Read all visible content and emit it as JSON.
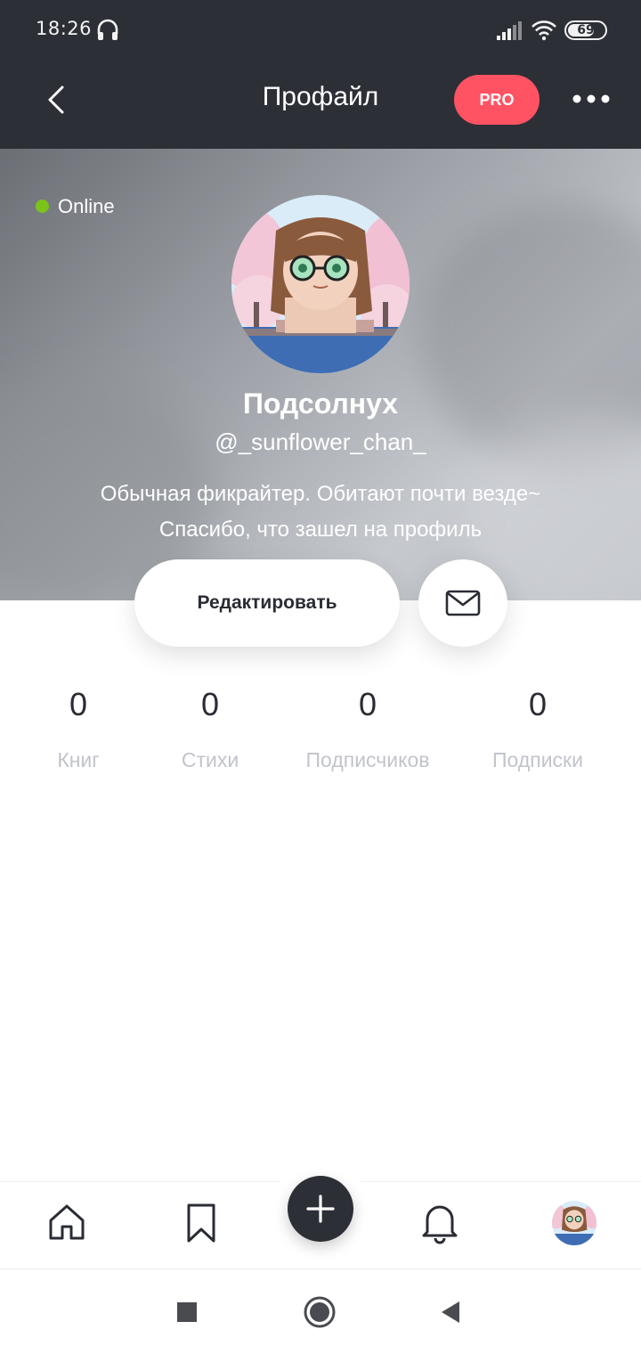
{
  "status_bar": {
    "time": "18:26",
    "battery": "69"
  },
  "app_bar": {
    "title": "Профайл",
    "pro_label": "PRO"
  },
  "profile": {
    "status": "Online",
    "name": "Подсолнух",
    "handle": "@_sunflower_chan_",
    "bio_line1": "Обычная фикрайтер. Обитают почти везде~",
    "bio_line2": "Спасибо, что зашел на профиль"
  },
  "actions": {
    "edit_label": "Редактировать"
  },
  "stats": [
    {
      "value": "0",
      "label": "Книг"
    },
    {
      "value": "0",
      "label": "Стихи"
    },
    {
      "value": "0",
      "label": "Подписчиков"
    },
    {
      "value": "0",
      "label": "Подписки"
    }
  ],
  "bottom_nav": [
    "home-icon",
    "bookmark-icon",
    "plus-icon",
    "bell-icon",
    "profile-avatar"
  ],
  "colors": {
    "header_bg": "#2d2f37",
    "pro_accent": "#ff5363",
    "online": "#7bc31a",
    "muted_label": "#c2c4cb"
  }
}
